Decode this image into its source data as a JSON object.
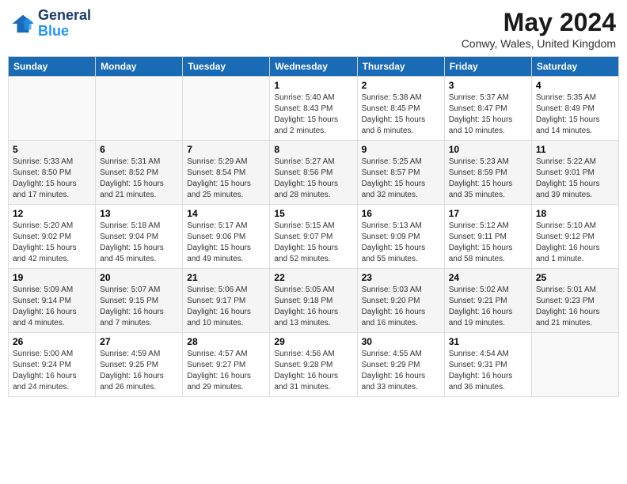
{
  "logo": {
    "line1": "General",
    "line2": "Blue"
  },
  "title": "May 2024",
  "subtitle": "Conwy, Wales, United Kingdom",
  "days_of_week": [
    "Sunday",
    "Monday",
    "Tuesday",
    "Wednesday",
    "Thursday",
    "Friday",
    "Saturday"
  ],
  "weeks": [
    [
      {
        "day": "",
        "info": ""
      },
      {
        "day": "",
        "info": ""
      },
      {
        "day": "",
        "info": ""
      },
      {
        "day": "1",
        "info": "Sunrise: 5:40 AM\nSunset: 8:43 PM\nDaylight: 15 hours\nand 2 minutes."
      },
      {
        "day": "2",
        "info": "Sunrise: 5:38 AM\nSunset: 8:45 PM\nDaylight: 15 hours\nand 6 minutes."
      },
      {
        "day": "3",
        "info": "Sunrise: 5:37 AM\nSunset: 8:47 PM\nDaylight: 15 hours\nand 10 minutes."
      },
      {
        "day": "4",
        "info": "Sunrise: 5:35 AM\nSunset: 8:49 PM\nDaylight: 15 hours\nand 14 minutes."
      }
    ],
    [
      {
        "day": "5",
        "info": "Sunrise: 5:33 AM\nSunset: 8:50 PM\nDaylight: 15 hours\nand 17 minutes."
      },
      {
        "day": "6",
        "info": "Sunrise: 5:31 AM\nSunset: 8:52 PM\nDaylight: 15 hours\nand 21 minutes."
      },
      {
        "day": "7",
        "info": "Sunrise: 5:29 AM\nSunset: 8:54 PM\nDaylight: 15 hours\nand 25 minutes."
      },
      {
        "day": "8",
        "info": "Sunrise: 5:27 AM\nSunset: 8:56 PM\nDaylight: 15 hours\nand 28 minutes."
      },
      {
        "day": "9",
        "info": "Sunrise: 5:25 AM\nSunset: 8:57 PM\nDaylight: 15 hours\nand 32 minutes."
      },
      {
        "day": "10",
        "info": "Sunrise: 5:23 AM\nSunset: 8:59 PM\nDaylight: 15 hours\nand 35 minutes."
      },
      {
        "day": "11",
        "info": "Sunrise: 5:22 AM\nSunset: 9:01 PM\nDaylight: 15 hours\nand 39 minutes."
      }
    ],
    [
      {
        "day": "12",
        "info": "Sunrise: 5:20 AM\nSunset: 9:02 PM\nDaylight: 15 hours\nand 42 minutes."
      },
      {
        "day": "13",
        "info": "Sunrise: 5:18 AM\nSunset: 9:04 PM\nDaylight: 15 hours\nand 45 minutes."
      },
      {
        "day": "14",
        "info": "Sunrise: 5:17 AM\nSunset: 9:06 PM\nDaylight: 15 hours\nand 49 minutes."
      },
      {
        "day": "15",
        "info": "Sunrise: 5:15 AM\nSunset: 9:07 PM\nDaylight: 15 hours\nand 52 minutes."
      },
      {
        "day": "16",
        "info": "Sunrise: 5:13 AM\nSunset: 9:09 PM\nDaylight: 15 hours\nand 55 minutes."
      },
      {
        "day": "17",
        "info": "Sunrise: 5:12 AM\nSunset: 9:11 PM\nDaylight: 15 hours\nand 58 minutes."
      },
      {
        "day": "18",
        "info": "Sunrise: 5:10 AM\nSunset: 9:12 PM\nDaylight: 16 hours\nand 1 minute."
      }
    ],
    [
      {
        "day": "19",
        "info": "Sunrise: 5:09 AM\nSunset: 9:14 PM\nDaylight: 16 hours\nand 4 minutes."
      },
      {
        "day": "20",
        "info": "Sunrise: 5:07 AM\nSunset: 9:15 PM\nDaylight: 16 hours\nand 7 minutes."
      },
      {
        "day": "21",
        "info": "Sunrise: 5:06 AM\nSunset: 9:17 PM\nDaylight: 16 hours\nand 10 minutes."
      },
      {
        "day": "22",
        "info": "Sunrise: 5:05 AM\nSunset: 9:18 PM\nDaylight: 16 hours\nand 13 minutes."
      },
      {
        "day": "23",
        "info": "Sunrise: 5:03 AM\nSunset: 9:20 PM\nDaylight: 16 hours\nand 16 minutes."
      },
      {
        "day": "24",
        "info": "Sunrise: 5:02 AM\nSunset: 9:21 PM\nDaylight: 16 hours\nand 19 minutes."
      },
      {
        "day": "25",
        "info": "Sunrise: 5:01 AM\nSunset: 9:23 PM\nDaylight: 16 hours\nand 21 minutes."
      }
    ],
    [
      {
        "day": "26",
        "info": "Sunrise: 5:00 AM\nSunset: 9:24 PM\nDaylight: 16 hours\nand 24 minutes."
      },
      {
        "day": "27",
        "info": "Sunrise: 4:59 AM\nSunset: 9:25 PM\nDaylight: 16 hours\nand 26 minutes."
      },
      {
        "day": "28",
        "info": "Sunrise: 4:57 AM\nSunset: 9:27 PM\nDaylight: 16 hours\nand 29 minutes."
      },
      {
        "day": "29",
        "info": "Sunrise: 4:56 AM\nSunset: 9:28 PM\nDaylight: 16 hours\nand 31 minutes."
      },
      {
        "day": "30",
        "info": "Sunrise: 4:55 AM\nSunset: 9:29 PM\nDaylight: 16 hours\nand 33 minutes."
      },
      {
        "day": "31",
        "info": "Sunrise: 4:54 AM\nSunset: 9:31 PM\nDaylight: 16 hours\nand 36 minutes."
      },
      {
        "day": "",
        "info": ""
      }
    ]
  ]
}
